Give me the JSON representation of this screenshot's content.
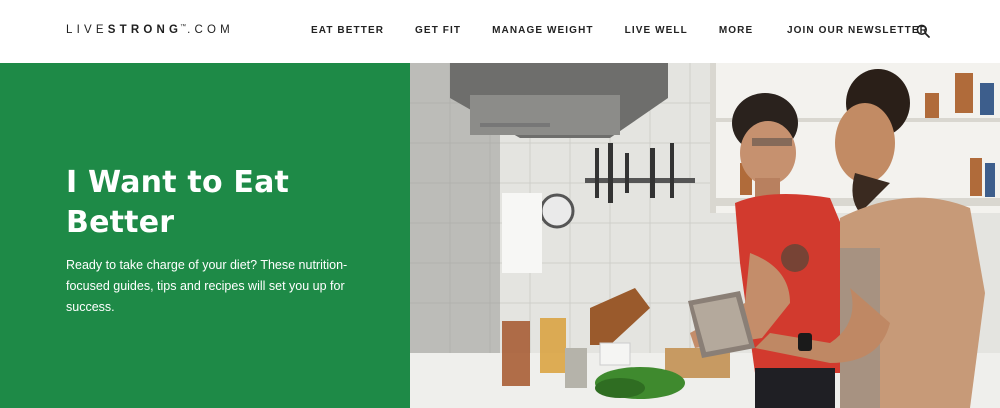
{
  "header": {
    "logo": {
      "left": "LIVE",
      "middle": "STRONG",
      "tm": "™",
      "right": ".COM"
    },
    "nav": [
      {
        "label": "EAT BETTER"
      },
      {
        "label": "GET FIT"
      },
      {
        "label": "MANAGE WEIGHT"
      },
      {
        "label": "LIVE WELL"
      },
      {
        "label": "MORE"
      }
    ],
    "newsletter_label": "JOIN OUR NEWSLETTER",
    "search_icon": "search-icon"
  },
  "hero": {
    "title": "I Want to Eat Better",
    "description": "Ready to take charge of your diet? These nutrition-focused guides, tips and recipes will set you up for success.",
    "panel_color": "#1e8a47"
  }
}
